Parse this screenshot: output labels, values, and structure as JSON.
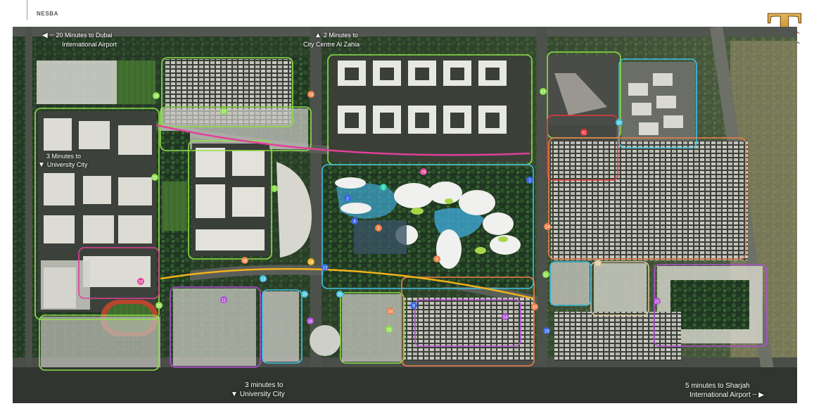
{
  "brand": {
    "name": "NESBA"
  },
  "logo": {
    "letter": "T"
  },
  "callouts": {
    "dubai_airport": {
      "line1": "20 Minutes to Dubai",
      "line2": "International Airport",
      "arrow": "◀ ┈"
    },
    "al_zahia": {
      "line1": "2 Minutes to",
      "line2": "City Centre Al Zahia",
      "arrow": "▲"
    },
    "university_left": {
      "line1": "3 Minutes to",
      "line2": "University City",
      "arrow": "▼"
    },
    "university_bottom": {
      "line1": "3 minutes to",
      "line2": "University City",
      "arrow": "▼"
    },
    "sharjah_airport": {
      "line1": "5 minutes to Sharjah",
      "line2": "International Airport",
      "arrow": "┈ ▶"
    }
  },
  "colors": {
    "green": "#8fe04a",
    "pink": "#e0409a",
    "yellow": "#f2b21b",
    "purple": "#b14fd6",
    "cyan": "#3fc3e6",
    "red": "#e8343a",
    "orange": "#f0814a",
    "blue": "#3a67e6",
    "sand": "#d9c59a",
    "teal": "#2fd0b2"
  },
  "markers": [
    {
      "label": "1"
    },
    {
      "label": "2"
    },
    {
      "label": "3"
    },
    {
      "label": "4"
    },
    {
      "label": "5"
    },
    {
      "label": "6"
    },
    {
      "label": "7"
    },
    {
      "label": "9"
    },
    {
      "label": "10"
    },
    {
      "label": "11"
    },
    {
      "label": "12"
    },
    {
      "label": "13"
    },
    {
      "label": "14"
    },
    {
      "label": "15"
    },
    {
      "label": "16"
    },
    {
      "label": "17"
    },
    {
      "label": "18"
    },
    {
      "label": "19"
    },
    {
      "label": "20"
    },
    {
      "label": "21"
    },
    {
      "label": "22"
    },
    {
      "label": "23"
    },
    {
      "label": "24"
    },
    {
      "label": "25"
    },
    {
      "label": "26"
    },
    {
      "label": "27"
    },
    {
      "label": "28"
    },
    {
      "label": "29"
    },
    {
      "label": "30"
    },
    {
      "label": "31"
    },
    {
      "label": "32"
    },
    {
      "label": "33"
    },
    {
      "label": "34"
    },
    {
      "label": "35"
    },
    {
      "label": "36"
    }
  ]
}
